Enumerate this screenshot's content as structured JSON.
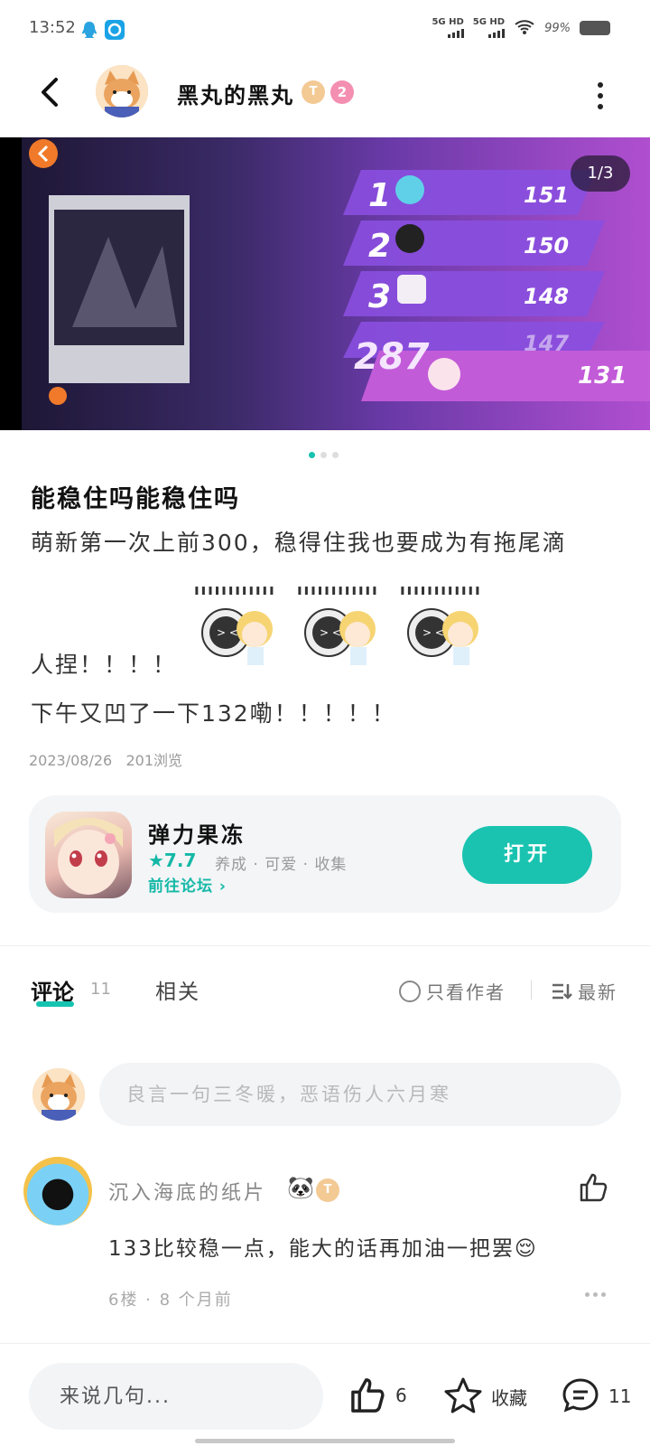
{
  "status_bar": {
    "time": "13:52",
    "network1": "5G HD",
    "network2": "5G HD",
    "battery": "99%"
  },
  "header": {
    "author": "黑丸的黑丸",
    "badge_t": "T",
    "badge_level": "2"
  },
  "hero": {
    "pager": "1/3"
  },
  "post": {
    "title": "能稳住吗能稳住吗",
    "line1": "萌新第一次上前300，稳得住我也要成为有拖尾滴",
    "line2": "人捏！！！！",
    "line3": "下午又凹了一下132嘞！！！！！",
    "date": "2023/08/26",
    "views": "201浏览"
  },
  "app_card": {
    "name": "弹力果冻",
    "rating": "★7.7",
    "tags": "养成 · 可爱 · 收集",
    "forum_link": "前往论坛 ",
    "open_button": "打开"
  },
  "tabs": {
    "comments": "评论",
    "comments_count": "11",
    "related": "相关",
    "author_only": "只看作者",
    "sort": "最新"
  },
  "comment_box": {
    "placeholder": "良言一句三冬暖，恶语伤人六月寒"
  },
  "comments": [
    {
      "user": "沉入海底的纸片",
      "badge": "T",
      "text": "133比较稳一点，能大的话再加油一把罢😌",
      "meta": "6楼 · 8 个月前"
    }
  ],
  "bottom_bar": {
    "placeholder": "来说几句...",
    "like_count": "6",
    "favorite_label": "收藏",
    "comment_count": "11"
  },
  "colors": {
    "accent": "#19c3b0",
    "badge_gold": "#f3c994",
    "badge_pink": "#f48fb1"
  }
}
